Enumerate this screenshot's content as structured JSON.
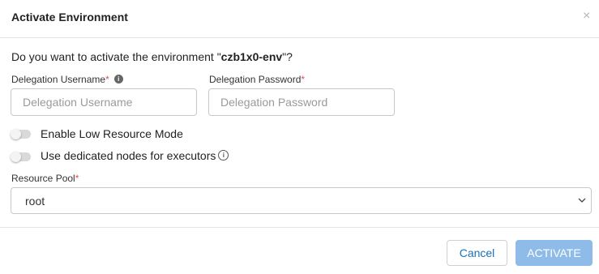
{
  "dialog": {
    "title": "Activate Environment",
    "close_glyph": "×",
    "question_prefix": "Do you want to activate the environment \"",
    "environment_name": "czb1x0-env",
    "question_suffix": "\"?"
  },
  "form": {
    "username": {
      "label": "Delegation Username",
      "required_mark": "*",
      "info_glyph": "i",
      "value": "",
      "placeholder": "Delegation Username"
    },
    "password": {
      "label": "Delegation Password",
      "required_mark": "*",
      "value": "",
      "placeholder": "Delegation Password"
    },
    "toggles": [
      {
        "label": "Enable Low Resource Mode",
        "enabled": false
      },
      {
        "label": "Use dedicated nodes for executors",
        "enabled": false,
        "info_glyph": "i"
      }
    ],
    "resource_pool": {
      "label": "Resource Pool",
      "required_mark": "*",
      "selected": "root"
    }
  },
  "footer": {
    "cancel_label": "Cancel",
    "activate_label": "ACTIVATE"
  },
  "colors": {
    "accent": "#1b6fb8",
    "activate_disabled_bg": "#8fbbe8",
    "required": "#d9534f"
  }
}
